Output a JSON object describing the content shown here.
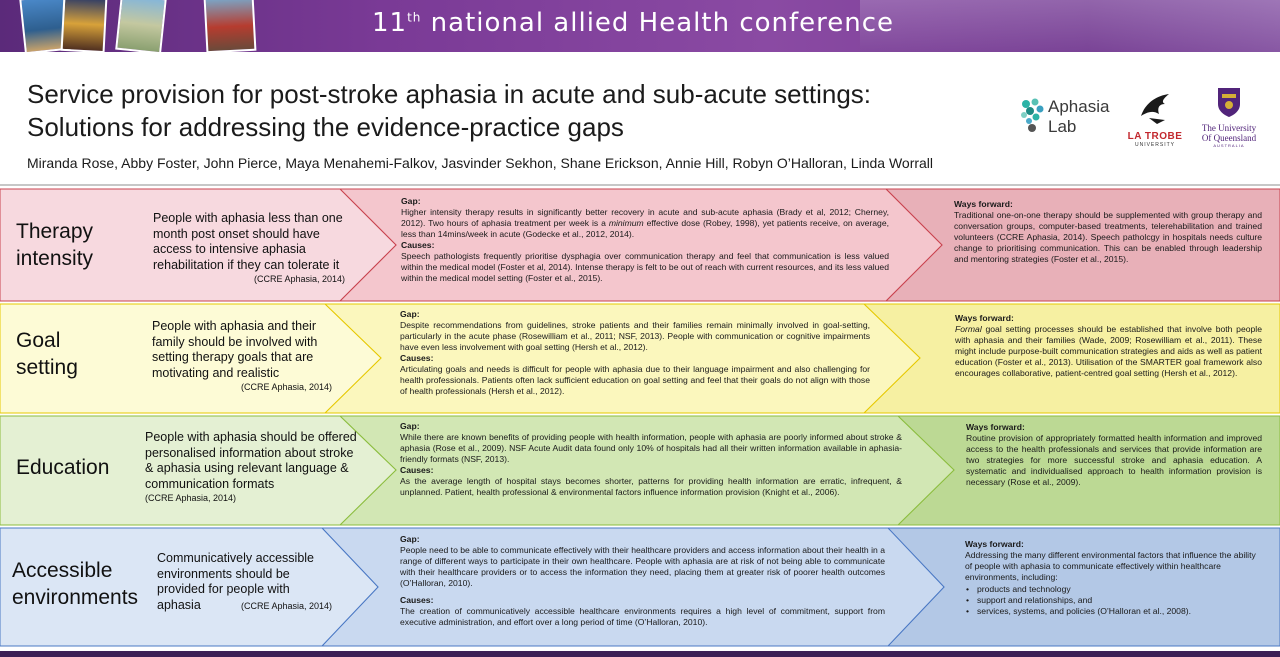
{
  "banner": {
    "ordinal": "11",
    "ordinal_suffix": "th",
    "conference_name": "national allied Health conference"
  },
  "title": {
    "line1": "Service provision for post-stroke aphasia in acute and sub-acute settings:",
    "line2": "Solutions for addressing the evidence-practice gaps"
  },
  "authors": "Miranda Rose, Abby Foster, John Pierce, Maya Menahemi-Falkov, Jasvinder Sekhon, Shane Erickson, Annie Hill, Robyn O’Halloran, Linda Worrall",
  "logos": {
    "aphasia_lab": {
      "line1": "Aphasia",
      "line2": "Lab"
    },
    "latrobe": {
      "name": "LA TROBE",
      "sub": "UNIVERSITY"
    },
    "uq": {
      "line1": "The University",
      "line2": "Of Queensland",
      "sub": "AUSTRALIA"
    }
  },
  "rows": [
    {
      "label_line1": "Therapy",
      "label_line2": "intensity",
      "summary": "People with aphasia less than one month post onset should have access to intensive aphasia rehabilitation if they can tolerate it",
      "summary_cite": "(CCRE Aphasia, 2014)",
      "gap_heading": "Gap:",
      "gap_text_before": "Higher intensity therapy results in significantly better recovery in acute and sub-acute aphasia (Brady et al, 2012; Cherney, 2012). Two hours of aphasia treatment per week is a ",
      "gap_text_italic": "minimum",
      "gap_text_after": " effective dose (Robey, 1998), yet patients receive, on average, less than 14mins/week in acute (Godecke et al., 2012, 2014).",
      "causes_heading": "Causes:",
      "causes_text": "Speech pathologists frequently prioritise dysphagia over communication therapy and feel that communication is less valued within the medical model (Foster et al, 2014). Intense therapy is felt to be out of reach with current resources, and its less valued within the medical model setting  (Foster et al., 2015).",
      "forward_heading": "Ways forward:",
      "forward_text": "Traditional one-on-one therapy should be supplemented with group therapy and conversation groups, computer-based treatments, telerehabilitation and trained volunteers (CCRE Aphasia, 2014). Speech patholcgy in hospitals needs culture change to prioritising communication. This can be enabled through leadership and mentoring strategies (Foster et al., 2015).",
      "colors": {
        "left": "#f7d9df",
        "mid": "#f4c6cd",
        "right": "#e8b0b8",
        "stroke": "#c9434f"
      }
    },
    {
      "label_line1": "Goal",
      "label_line2": "setting",
      "summary": "People with aphasia and their family should be involved with setting therapy goals that are motivating and realistic",
      "summary_cite": "(CCRE Aphasia, 2014)",
      "gap_heading": "Gap:",
      "gap_text": "Despite recommendations from guidelines, stroke patients and their families remain minimally involved in goal-setting, particularly in the acute phase (Rosewilliam et al., 2011; NSF, 2013). People with communication or cognitive impairments have even less involvement with goal setting (Hersh et al., 2012).",
      "causes_heading": "Causes:",
      "causes_text": "Articulating goals and needs is difficult for people with aphasia due to their language impairment and also challenging for health professionals. Patients often lack sufficient education on goal setting and feel that their goals do not align with those of health professionals (Hersh et al., 2012).",
      "forward_heading": "Ways forward:",
      "forward_italic": "Formal",
      "forward_text": " goal setting processes should be established that involve both people with aphasia and their families (Wade, 2009; Rosewilliam et al., 2011). These might include purpose-built communication strategies and aids as well as patient education (Foster et al., 2013). Utilisation of the SMARTER goal framework also encourages collaborative, patient-centred goal setting (Hersh et al., 2012).",
      "colors": {
        "left": "#fdfbd6",
        "mid": "#fbf7bd",
        "right": "#f6f0a2",
        "stroke": "#e6c800"
      }
    },
    {
      "label_line1": "Education",
      "label_line2": "",
      "summary": "People with aphasia should be offered personalised information about stroke & aphasia using relevant language & communication formats",
      "summary_cite": "(CCRE Aphasia, 2014)",
      "gap_heading": "Gap:",
      "gap_text": "While there are known benefits of providing people with health information, people with aphasia are poorly informed about stroke & aphasia (Rose et al., 2009). NSF Acute Audit data found only 10% of hospitals had all their written information available in  aphasia-friendly formats (NSF, 2013).",
      "causes_heading": "Causes:",
      "causes_text": "As the average length of hospital stays becomes shorter, patterns for providing health information are erratic, infrequent, & unplanned. Patient, health professional & environmental factors influence information provision (Knight et al., 2006).",
      "forward_heading": "Ways forward:",
      "forward_text": "Routine provision of appropriately formatted health information and improved access to the health professionals and services that provide information are two strategies for more successful stroke and aphasia education. A systematic and individualised approach to health information provision is necessary  (Rose et al., 2009).",
      "colors": {
        "left": "#e4f0d3",
        "mid": "#d2e7b4",
        "right": "#bcd994",
        "stroke": "#8bbd3e"
      }
    },
    {
      "label_line1": "Accessible",
      "label_line2": "environments",
      "summary": "Communicatively accessible environments should be provided for people with aphasia",
      "summary_cite": "(CCRE Aphasia, 2014)",
      "gap_heading": "Gap:",
      "gap_text": "People need to be able to communicate effectively with their healthcare providers and access information about their health in a range of different ways to participate in their own healthcare. People with aphasia are at risk of not being able to communicate with their healthcare providers or to access the information they need, placing them at greater risk of poorer health outcomes (O’Halloran, 2010).",
      "causes_heading": "Causes:",
      "causes_text": "The creation of communicatively accessible healthcare environments requires a high level of commitment, support from executive administration, and effort over a long period of time (O’Halloran, 2010).",
      "forward_heading": "Ways forward:",
      "forward_text": "Addressing the many different environmental factors that influence the ability of people with aphasia to communicate effectively within healthcare environments, including:",
      "forward_bullets": [
        "products and technology",
        "support and relationships, and",
        "services, systems, and policies (O’Halloran et al., 2008)."
      ],
      "colors": {
        "left": "#dbe6f5",
        "mid": "#c9d9f0",
        "right": "#b3c8e6",
        "stroke": "#4a78c4"
      }
    }
  ]
}
